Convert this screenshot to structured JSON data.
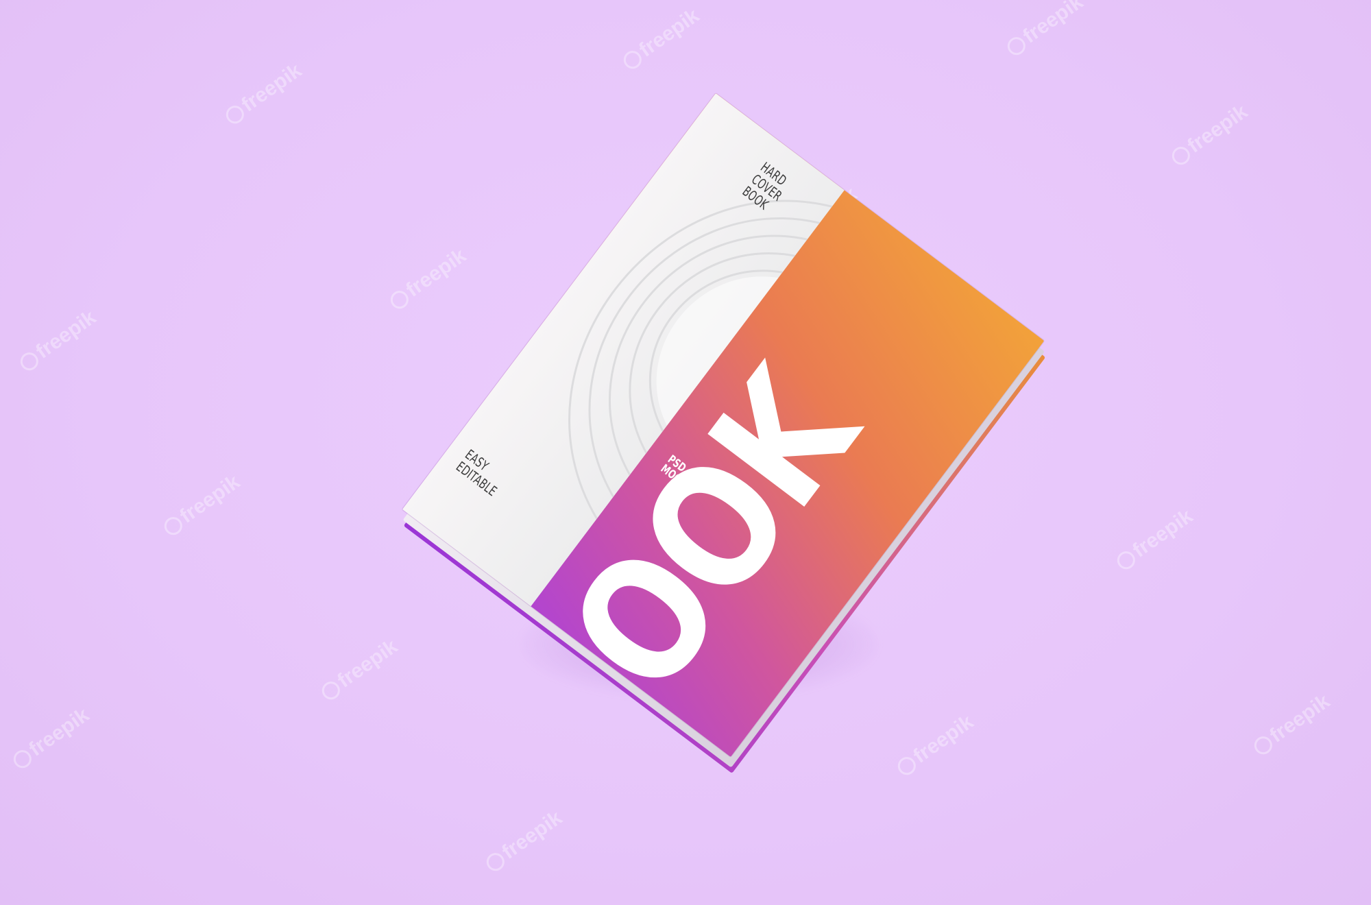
{
  "image": {
    "background_color": "#e8c8fb",
    "subject": "square hard cover book mockup floating at an angle"
  },
  "book": {
    "cover_gradient": [
      "#f2a23a",
      "#ea7b52",
      "#d0569e",
      "#a83fe0"
    ],
    "panel_color": "#f3f3f4",
    "top_line_1": "HARD COVER",
    "top_line_2": "BOOK",
    "bottom_line_1": "EASY",
    "bottom_line_2": "EDITABLE",
    "small_line_1": "PSD",
    "small_line_2": "MOCKUP",
    "big_word": "BOOK"
  },
  "watermark": {
    "text": "freepik",
    "icon": "freepik-logo-icon"
  }
}
